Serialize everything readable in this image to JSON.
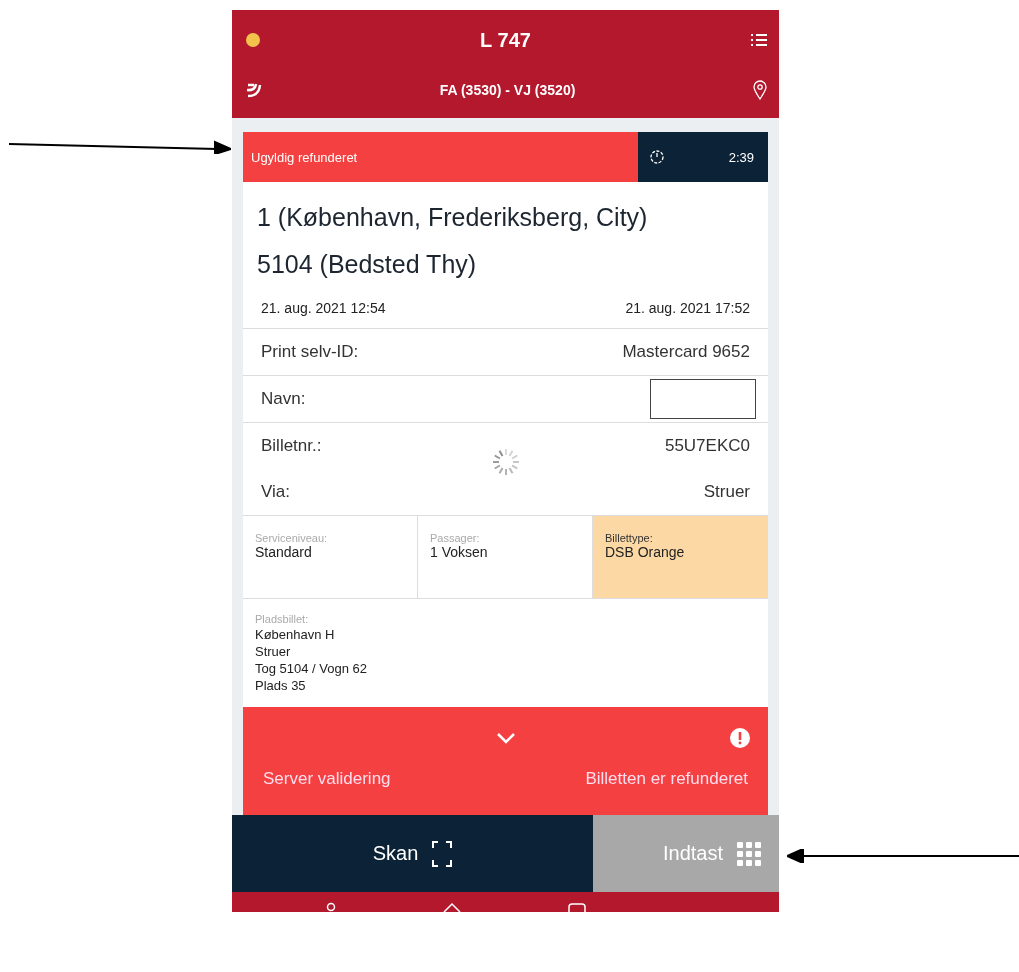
{
  "header": {
    "title": "L 747",
    "route": "FA (3530) - VJ (3520)"
  },
  "status": {
    "label": "Ugyldig refunderet",
    "timer": "2:39"
  },
  "ticket": {
    "zones": [
      "1 (København, Frederiksberg, City)",
      "5104 (Bedsted Thy)"
    ],
    "departure": "21. aug. 2021 12:54",
    "arrival": "21. aug. 2021 17:52",
    "rows": [
      {
        "kind": "text",
        "label": "Print selv-ID:",
        "value": "Mastercard 9652"
      },
      {
        "kind": "field",
        "label": "Navn:"
      },
      {
        "kind": "text",
        "label": "Billetnr.:",
        "value": "55U7EKC0"
      },
      {
        "kind": "text",
        "label": "Via:",
        "value": "Struer"
      }
    ],
    "cells": [
      {
        "label": "Serviceniveau:",
        "value": "Standard",
        "highlighted": false
      },
      {
        "label": "Passager:",
        "value": "1 Voksen",
        "highlighted": false
      },
      {
        "label": "Billettype:",
        "value": "DSB Orange",
        "highlighted": true
      }
    ],
    "seat": {
      "label": "Pladsbillet:",
      "lines": [
        "København H",
        "Struer",
        "Tog 5104 / Vogn 62",
        "Plads 35"
      ]
    }
  },
  "alert": {
    "source": "Server validering",
    "message": "Billetten er refunderet"
  },
  "actions": [
    {
      "kind": "scan",
      "label": "Skan",
      "selected": true
    },
    {
      "kind": "keypad",
      "label": "Indtast",
      "selected": false
    }
  ]
}
